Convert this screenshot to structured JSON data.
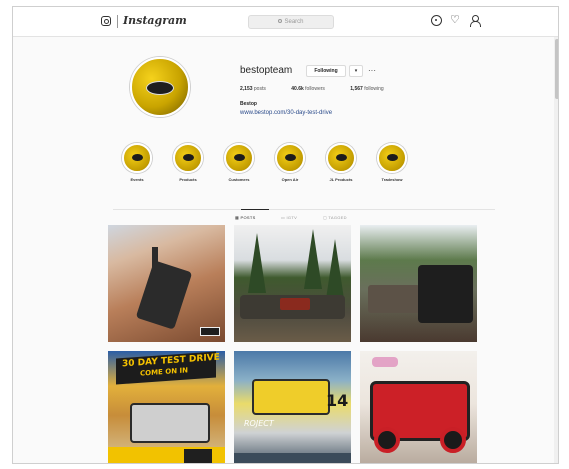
{
  "app": {
    "logo_text": "Instagram",
    "search_placeholder": "Search"
  },
  "nav": {
    "icons": [
      "instagram-glyph",
      "explore-compass",
      "heart",
      "profile-person"
    ]
  },
  "profile": {
    "username": "bestopteam",
    "follow_label": "Following",
    "dropdown_label": "▾",
    "more_label": "···",
    "stats": {
      "posts_count": "2,153",
      "posts_label": "posts",
      "followers_count": "40.6k",
      "followers_label": "followers",
      "following_count": "1,567",
      "following_label": "following"
    },
    "bio_name": "Bestop",
    "bio_link": "www.bestop.com/30-day-test-drive"
  },
  "highlights": [
    {
      "label": "Events"
    },
    {
      "label": "Products"
    },
    {
      "label": "Customers"
    },
    {
      "label": "Open Air"
    },
    {
      "label": "JL Products"
    },
    {
      "label": "Tradeshow"
    }
  ],
  "tabs": [
    {
      "label": "POSTS",
      "active": true
    },
    {
      "label": "IGTV",
      "active": false
    },
    {
      "label": "TAGGED",
      "active": false
    }
  ],
  "posts": {
    "tile4_headline": "30 DAY TEST DRIVE",
    "tile4_sub": "COME ON IN",
    "tile5_logo": "ROJECT",
    "tile5_number": "14"
  },
  "colors": {
    "brand_yellow": "#f2c200",
    "link_blue": "#2a4a8a",
    "text_dark": "#262626"
  }
}
